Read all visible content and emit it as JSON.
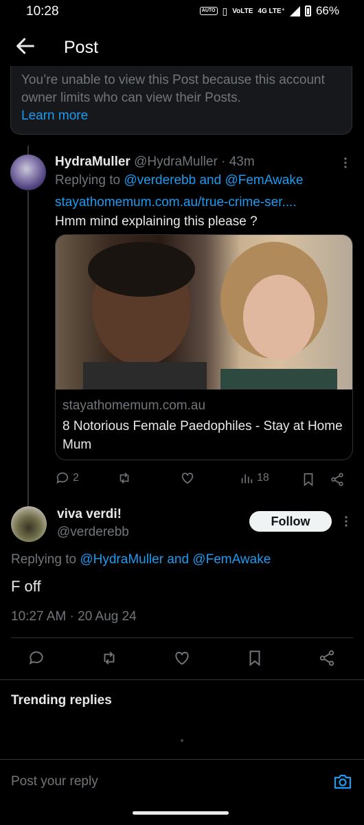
{
  "status_bar": {
    "time": "10:28",
    "auto": "AUTO",
    "volte": "VoLTE",
    "network": "4G LTE⁺",
    "battery": "66%"
  },
  "header": {
    "title": "Post"
  },
  "notice": {
    "text": "You’re unable to view this Post because this account owner limits who can view their Posts.",
    "link": "Learn more"
  },
  "reply_post": {
    "display_name": "HydraMuller",
    "handle": "@HydraMuller",
    "dot": "·",
    "time": "43m",
    "replying_prefix": "Replying to",
    "replying_to": "@verderebb and @FemAwake",
    "link": "stayathomemum.com.au/true-crime-ser....",
    "text": "Hmm  mind explaining this please ?",
    "card": {
      "domain": "stayathomemum.com.au",
      "title": "8 Notorious Female Paedophiles - Stay at Home Mum"
    },
    "stats": {
      "replies": "2",
      "retweets": "",
      "likes": "",
      "views": "18"
    }
  },
  "main_post": {
    "display_name": "viva verdi!",
    "handle": "@verderebb",
    "follow_label": "Follow",
    "replying_prefix": "Replying to",
    "replying_to": "@HydraMuller and @FemAwake",
    "text": "F off",
    "timestamp": "10:27 AM · 20 Aug 24"
  },
  "trending": {
    "label": "Trending replies"
  },
  "composer": {
    "placeholder": "Post your reply"
  },
  "colors": {
    "accent": "#1d9bf0",
    "background": "#000000",
    "muted": "#71767b"
  }
}
